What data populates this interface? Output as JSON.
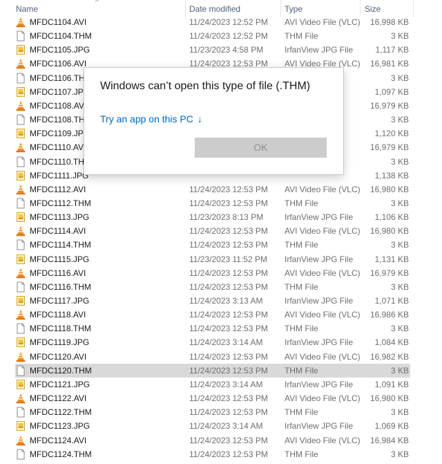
{
  "header": {
    "name": "Name",
    "date_modified": "Date modified",
    "type": "Type",
    "size": "Size"
  },
  "files": [
    {
      "name": "MFDC1104.AVI",
      "date": "11/24/2023 12:52 PM",
      "type": "AVI Video File (VLC)",
      "size": "16,998 KB",
      "icon": "vlc-cone-icon"
    },
    {
      "name": "MFDC1104.THM",
      "date": "11/24/2023 12:52 PM",
      "type": "THM File",
      "size": "3 KB",
      "icon": "blank-file-icon"
    },
    {
      "name": "MFDC1105.JPG",
      "date": "11/23/2023 4:58 PM",
      "type": "IrfanView JPG File",
      "size": "1,117 KB",
      "icon": "image-file-icon"
    },
    {
      "name": "MFDC1106.AVI",
      "date": "11/24/2023 12:53 PM",
      "type": "AVI Video File (VLC)",
      "size": "16,981 KB",
      "icon": "vlc-cone-icon"
    },
    {
      "name": "MFDC1106.THM",
      "date": "",
      "type": "",
      "size": "3 KB",
      "icon": "blank-file-icon"
    },
    {
      "name": "MFDC1107.JPG",
      "date": "",
      "type": "",
      "size": "1,097 KB",
      "icon": "image-file-icon"
    },
    {
      "name": "MFDC1108.AVI",
      "date": "",
      "type": "",
      "size": "16,979 KB",
      "icon": "vlc-cone-icon"
    },
    {
      "name": "MFDC1108.THM",
      "date": "",
      "type": "",
      "size": "3 KB",
      "icon": "blank-file-icon"
    },
    {
      "name": "MFDC1109.JPG",
      "date": "",
      "type": "",
      "size": "1,120 KB",
      "icon": "image-file-icon"
    },
    {
      "name": "MFDC1110.AVI",
      "date": "",
      "type": "",
      "size": "16,979 KB",
      "icon": "vlc-cone-icon"
    },
    {
      "name": "MFDC1110.THM",
      "date": "",
      "type": "",
      "size": "3 KB",
      "icon": "blank-file-icon"
    },
    {
      "name": "MFDC1111.JPG",
      "date": "",
      "type": "",
      "size": "1,138 KB",
      "icon": "image-file-icon"
    },
    {
      "name": "MFDC1112.AVI",
      "date": "11/24/2023 12:53 PM",
      "type": "AVI Video File (VLC)",
      "size": "16,980 KB",
      "icon": "vlc-cone-icon"
    },
    {
      "name": "MFDC1112.THM",
      "date": "11/24/2023 12:53 PM",
      "type": "THM File",
      "size": "3 KB",
      "icon": "blank-file-icon"
    },
    {
      "name": "MFDC1113.JPG",
      "date": "11/23/2023 8:13 PM",
      "type": "IrfanView JPG File",
      "size": "1,106 KB",
      "icon": "image-file-icon"
    },
    {
      "name": "MFDC1114.AVI",
      "date": "11/24/2023 12:53 PM",
      "type": "AVI Video File (VLC)",
      "size": "16,980 KB",
      "icon": "vlc-cone-icon"
    },
    {
      "name": "MFDC1114.THM",
      "date": "11/24/2023 12:53 PM",
      "type": "THM File",
      "size": "3 KB",
      "icon": "blank-file-icon"
    },
    {
      "name": "MFDC1115.JPG",
      "date": "11/23/2023 11:52 PM",
      "type": "IrfanView JPG File",
      "size": "1,131 KB",
      "icon": "image-file-icon"
    },
    {
      "name": "MFDC1116.AVI",
      "date": "11/24/2023 12:53 PM",
      "type": "AVI Video File (VLC)",
      "size": "16,979 KB",
      "icon": "vlc-cone-icon"
    },
    {
      "name": "MFDC1116.THM",
      "date": "11/24/2023 12:53 PM",
      "type": "THM File",
      "size": "3 KB",
      "icon": "blank-file-icon"
    },
    {
      "name": "MFDC1117.JPG",
      "date": "11/24/2023 3:13 AM",
      "type": "IrfanView JPG File",
      "size": "1,071 KB",
      "icon": "image-file-icon"
    },
    {
      "name": "MFDC1118.AVI",
      "date": "11/24/2023 12:53 PM",
      "type": "AVI Video File (VLC)",
      "size": "16,986 KB",
      "icon": "vlc-cone-icon"
    },
    {
      "name": "MFDC1118.THM",
      "date": "11/24/2023 12:53 PM",
      "type": "THM File",
      "size": "3 KB",
      "icon": "blank-file-icon"
    },
    {
      "name": "MFDC1119.JPG",
      "date": "11/24/2023 3:14 AM",
      "type": "IrfanView JPG File",
      "size": "1,084 KB",
      "icon": "image-file-icon"
    },
    {
      "name": "MFDC1120.AVI",
      "date": "11/24/2023 12:53 PM",
      "type": "AVI Video File (VLC)",
      "size": "16,982 KB",
      "icon": "vlc-cone-icon"
    },
    {
      "name": "MFDC1120.THM",
      "date": "11/24/2023 12:53 PM",
      "type": "THM File",
      "size": "3 KB",
      "icon": "blank-file-icon",
      "selected": true
    },
    {
      "name": "MFDC1121.JPG",
      "date": "11/24/2023 3:14 AM",
      "type": "IrfanView JPG File",
      "size": "1,091 KB",
      "icon": "image-file-icon"
    },
    {
      "name": "MFDC1122.AVI",
      "date": "11/24/2023 12:53 PM",
      "type": "AVI Video File (VLC)",
      "size": "16,980 KB",
      "icon": "vlc-cone-icon"
    },
    {
      "name": "MFDC1122.THM",
      "date": "11/24/2023 12:53 PM",
      "type": "THM File",
      "size": "3 KB",
      "icon": "blank-file-icon"
    },
    {
      "name": "MFDC1123.JPG",
      "date": "11/24/2023 3:14 AM",
      "type": "IrfanView JPG File",
      "size": "1,069 KB",
      "icon": "image-file-icon"
    },
    {
      "name": "MFDC1124.AVI",
      "date": "11/24/2023 12:53 PM",
      "type": "AVI Video File (VLC)",
      "size": "16,984 KB",
      "icon": "vlc-cone-icon"
    },
    {
      "name": "MFDC1124.THM",
      "date": "11/24/2023 12:53 PM",
      "type": "THM File",
      "size": "3 KB",
      "icon": "blank-file-icon"
    }
  ],
  "dialog": {
    "title": "Windows can’t open this type of file (.THM)",
    "link": "Try an app on this PC",
    "link_icon": "arrow-down-icon",
    "ok": "OK"
  },
  "colors": {
    "selection": "#d9d9d9",
    "link": "#0067c0",
    "vlc_orange": "#f08a1c",
    "jpg_yellow": "#f6c343"
  }
}
